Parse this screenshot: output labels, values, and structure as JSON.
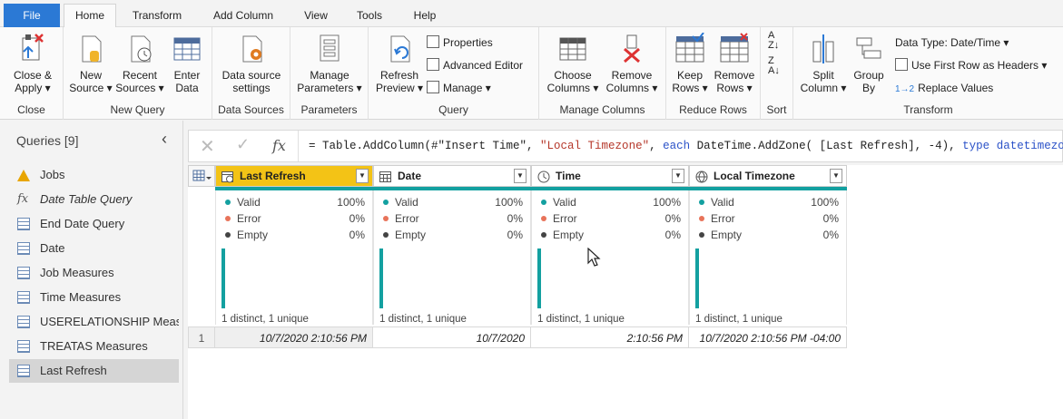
{
  "menu": {
    "tabs": [
      "File",
      "Home",
      "Transform",
      "Add Column",
      "View",
      "Tools",
      "Help"
    ],
    "active": "Home"
  },
  "ribbon": {
    "close": {
      "label": "Close &",
      "label2": "Apply",
      "group": "Close"
    },
    "new_query": {
      "new_source": {
        "label": "New",
        "label2": "Source"
      },
      "recent_sources": {
        "label": "Recent",
        "label2": "Sources"
      },
      "enter_data": {
        "label": "Enter",
        "label2": "Data"
      },
      "group": "New Query"
    },
    "data_sources": {
      "label": "Data source",
      "label2": "settings",
      "group": "Data Sources"
    },
    "parameters": {
      "label": "Manage",
      "label2": "Parameters",
      "group": "Parameters"
    },
    "query": {
      "refresh": {
        "label": "Refresh",
        "label2": "Preview"
      },
      "properties": "Properties",
      "advanced_editor": "Advanced Editor",
      "manage": "Manage",
      "group": "Query"
    },
    "manage_columns": {
      "choose": {
        "label": "Choose",
        "label2": "Columns"
      },
      "remove": {
        "label": "Remove",
        "label2": "Columns"
      },
      "group": "Manage Columns"
    },
    "reduce_rows": {
      "keep": {
        "label": "Keep",
        "label2": "Rows"
      },
      "remove": {
        "label": "Remove",
        "label2": "Rows"
      },
      "group": "Reduce Rows"
    },
    "sort": {
      "group": "Sort"
    },
    "transform": {
      "split": {
        "label": "Split",
        "label2": "Column"
      },
      "group_by": {
        "label": "Group",
        "label2": "By"
      },
      "data_type": "Data Type: Date/Time",
      "first_row": "Use First Row as Headers",
      "replace": "Replace Values",
      "group": "Transform"
    }
  },
  "queries": {
    "title": "Queries [9]",
    "items": [
      {
        "label": "Jobs",
        "icon": "warning-icon"
      },
      {
        "label": "Date Table Query",
        "icon": "fx-icon"
      },
      {
        "label": "End Date Query",
        "icon": "table-icon"
      },
      {
        "label": "Date",
        "icon": "table-icon"
      },
      {
        "label": "Job Measures",
        "icon": "table-icon"
      },
      {
        "label": "Time Measures",
        "icon": "table-icon"
      },
      {
        "label": "USERELATIONSHIP Meas...",
        "icon": "table-icon"
      },
      {
        "label": "TREATAS Measures",
        "icon": "table-icon"
      },
      {
        "label": "Last Refresh",
        "icon": "table-icon"
      }
    ],
    "selected": "Last Refresh"
  },
  "formula": {
    "prefix": "= Table.AddColumn(#\"Insert Time\", ",
    "str1": "\"Local Timezone\"",
    "mid1": ", ",
    "kw1": "each",
    "mid2": " DateTime.AddZone( [Last Refresh], -4), ",
    "kw2": "type",
    "sp": " ",
    "kw3": "datetimezone",
    "suffix": " )"
  },
  "grid": {
    "columns": [
      {
        "name": "Last Refresh",
        "valid": "100%",
        "error": "0%",
        "empty": "0%",
        "distinct": "1 distinct, 1 unique",
        "value": "10/7/2020 2:10:56 PM"
      },
      {
        "name": "Date",
        "valid": "100%",
        "error": "0%",
        "empty": "0%",
        "distinct": "1 distinct, 1 unique",
        "value": "10/7/2020"
      },
      {
        "name": "Time",
        "valid": "100%",
        "error": "0%",
        "empty": "0%",
        "distinct": "1 distinct, 1 unique",
        "value": "2:10:56 PM"
      },
      {
        "name": "Local Timezone",
        "valid": "100%",
        "error": "0%",
        "empty": "0%",
        "distinct": "1 distinct, 1 unique",
        "value": "10/7/2020 2:10:56 PM -04:00"
      }
    ],
    "quality_labels": {
      "valid": "Valid",
      "error": "Error",
      "empty": "Empty"
    },
    "row_number": "1"
  },
  "colors": {
    "accent": "#2b79d5",
    "selected_header": "#f3c316",
    "teal": "#13a0a0",
    "error": "#e8735a"
  }
}
